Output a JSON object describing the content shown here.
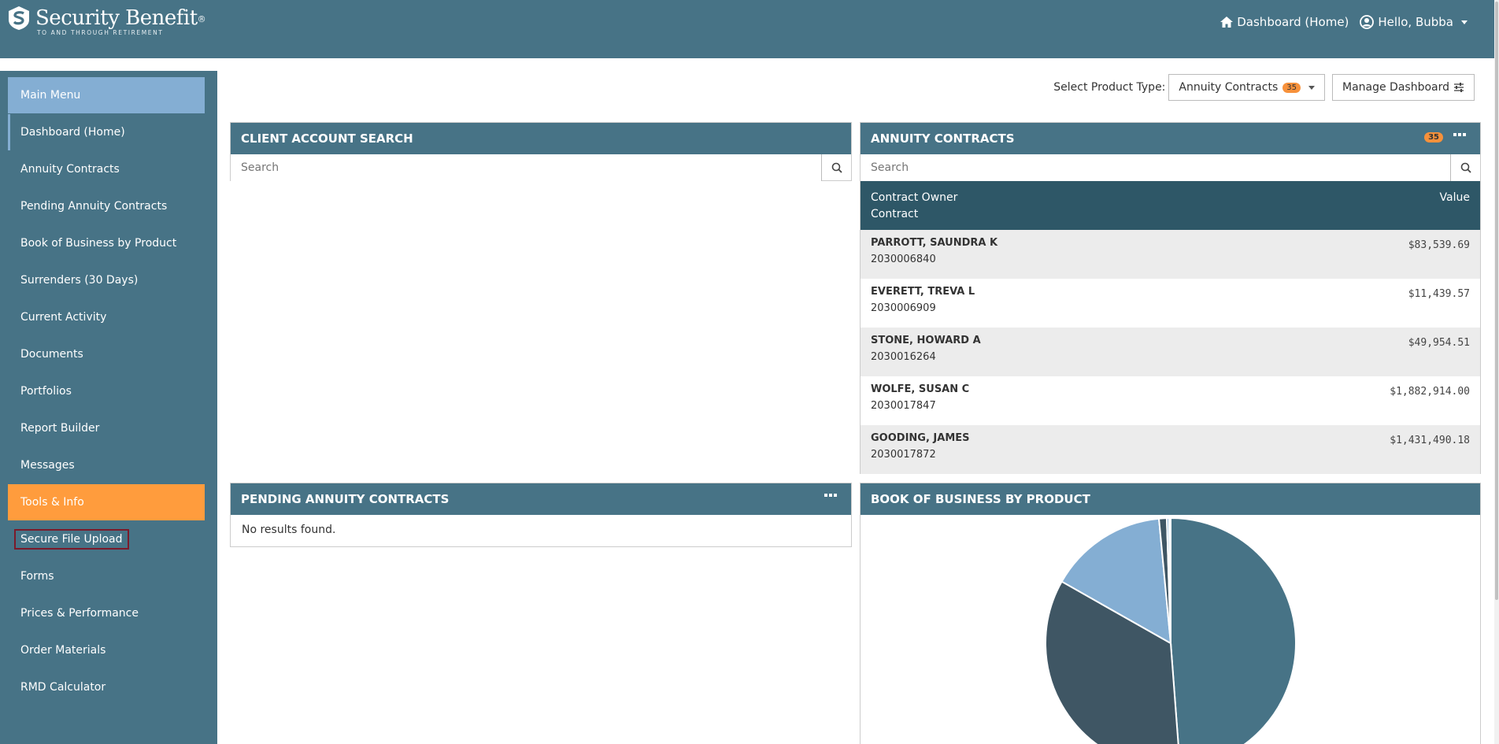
{
  "brand": {
    "name": "Security Benefit",
    "tagline": "TO AND THROUGH RETIREMENT"
  },
  "topnav": {
    "dashboard": "Dashboard (Home)",
    "user": "Hello, Bubba"
  },
  "sidebar": {
    "items": [
      {
        "label": "Main Menu"
      },
      {
        "label": "Dashboard (Home)"
      },
      {
        "label": "Annuity Contracts"
      },
      {
        "label": "Pending Annuity Contracts"
      },
      {
        "label": "Book of Business by Product"
      },
      {
        "label": "Surrenders (30 Days)"
      },
      {
        "label": "Current Activity"
      },
      {
        "label": "Documents"
      },
      {
        "label": "Portfolios"
      },
      {
        "label": "Report Builder"
      },
      {
        "label": "Messages"
      },
      {
        "label": "Tools & Info"
      },
      {
        "label": "Secure File Upload"
      },
      {
        "label": "Forms"
      },
      {
        "label": "Prices & Performance"
      },
      {
        "label": "Order Materials"
      },
      {
        "label": "RMD Calculator"
      }
    ]
  },
  "toolbar": {
    "product_label": "Select Product Type:",
    "product_value": "Annuity Contracts",
    "product_count": "35",
    "manage_label": "Manage Dashboard"
  },
  "client_search": {
    "title": "CLIENT ACCOUNT SEARCH",
    "placeholder": "Search"
  },
  "annuity": {
    "title": "ANNUITY CONTRACTS",
    "count": "35",
    "placeholder": "Search",
    "col_owner": "Contract Owner",
    "col_contract": "Contract",
    "col_value": "Value",
    "rows": [
      {
        "owner": "PARROTT, SAUNDRA K",
        "contract": "2030006840",
        "value": "$83,539.69"
      },
      {
        "owner": "EVERETT, TREVA L",
        "contract": "2030006909",
        "value": "$11,439.57"
      },
      {
        "owner": "STONE, HOWARD A",
        "contract": "2030016264",
        "value": "$49,954.51"
      },
      {
        "owner": "WOLFE, SUSAN C",
        "contract": "2030017847",
        "value": "$1,882,914.00"
      },
      {
        "owner": "GOODING, JAMES",
        "contract": "2030017872",
        "value": "$1,431,490.18"
      }
    ]
  },
  "pending": {
    "title": "PENDING ANNUITY CONTRACTS",
    "empty": "No results found."
  },
  "book": {
    "title": "BOOK OF BUSINESS BY PRODUCT"
  },
  "chart_data": {
    "type": "pie",
    "values": [
      48.8,
      34.4,
      15.3,
      1.0,
      0.3,
      0.2
    ],
    "colors": [
      "#477386",
      "#3f5664",
      "#84aed3",
      "#3f5664",
      "#84aed3",
      "#3f5664"
    ],
    "title": ""
  }
}
